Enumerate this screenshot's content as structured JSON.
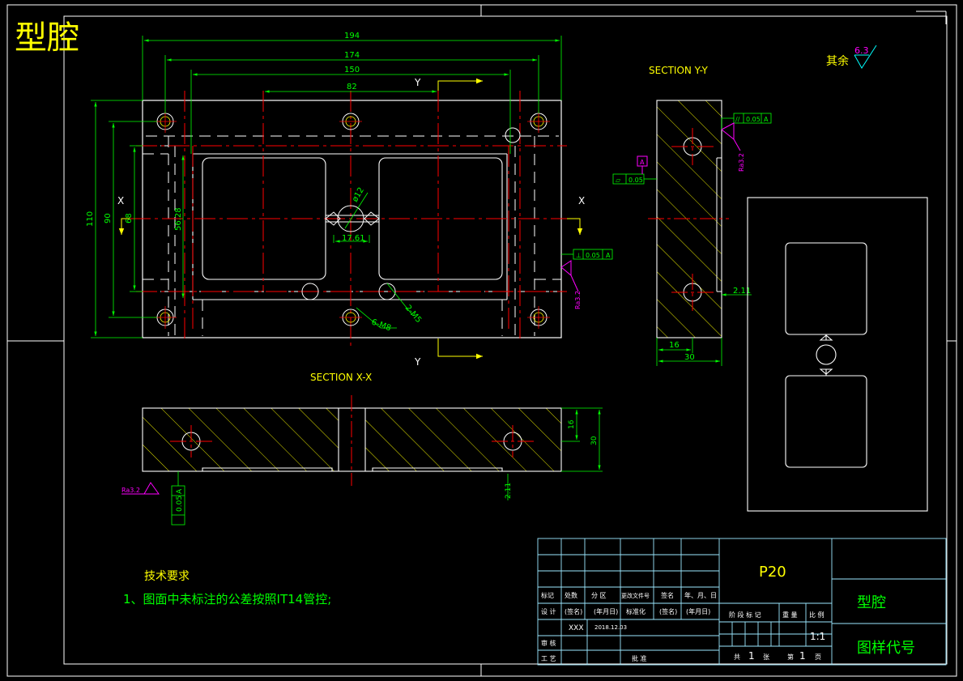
{
  "title": "型腔",
  "colors": {
    "bg": "#000000",
    "frame": "#ffffff",
    "dim": "#00ff00",
    "center": "#ff0000",
    "hidden": "#ffffff",
    "hatch": "#ffff00",
    "label": "#ffff00",
    "magenta": "#ff00ff",
    "blue": "#00ffff",
    "titleblock": "#9be8ff",
    "tbtext": "#00ff00"
  },
  "plan": {
    "dims": {
      "d194": "194",
      "d174": "174",
      "d150": "150",
      "d82": "82",
      "d110": "110",
      "d90": "90",
      "d68": "68",
      "d56": "56.28",
      "d12": "ø12",
      "d1761": "17.61",
      "dm8": "6-M8",
      "d2m5": "2-M5"
    },
    "cut_y": "Y",
    "cut_x": "X",
    "tol1": "0.05",
    "tol1_ref": "A",
    "rough": "Ra3.2"
  },
  "section_xx": {
    "label": "SECTION  X-X",
    "d16": "16",
    "d30": "30",
    "d211": "2.11",
    "rough": "Ra3.2",
    "tol": "0.05",
    "tol_ref": "A"
  },
  "section_yy": {
    "label": "SECTION  Y-Y",
    "tol_par": "0.05",
    "tol_par_ref": "A",
    "tol_flat": "0.05",
    "d16": "16",
    "d30": "30",
    "d211": "2.11",
    "rough": "Ra3.2",
    "datum": "A"
  },
  "surface_note": {
    "prefix": "其余",
    "value": "6.3"
  },
  "tech": {
    "heading": "技术要求",
    "line1": "1、图面中未标注的公差按照IT14管控;"
  },
  "titleblock": {
    "material": "P20",
    "part_name": "型腔",
    "drawing_no": "图样代号",
    "scale": "1:1",
    "hdr": [
      "标记",
      "处数",
      "分  区",
      "更改文件号",
      "签名",
      "年、月、日"
    ],
    "row_design": [
      "设 计",
      "(签名)",
      "(年月日)",
      "标准化",
      "(签名)",
      "(年月日)"
    ],
    "designer": "XXX",
    "date": "2018.12.03",
    "audit": "审  核",
    "process": "工  艺",
    "approve": "批  准",
    "stage_hdr": [
      "阶 段 标 记",
      "重 量",
      "比 例"
    ],
    "sheets": [
      "共",
      "1",
      "张",
      "第",
      "1",
      "页"
    ]
  }
}
